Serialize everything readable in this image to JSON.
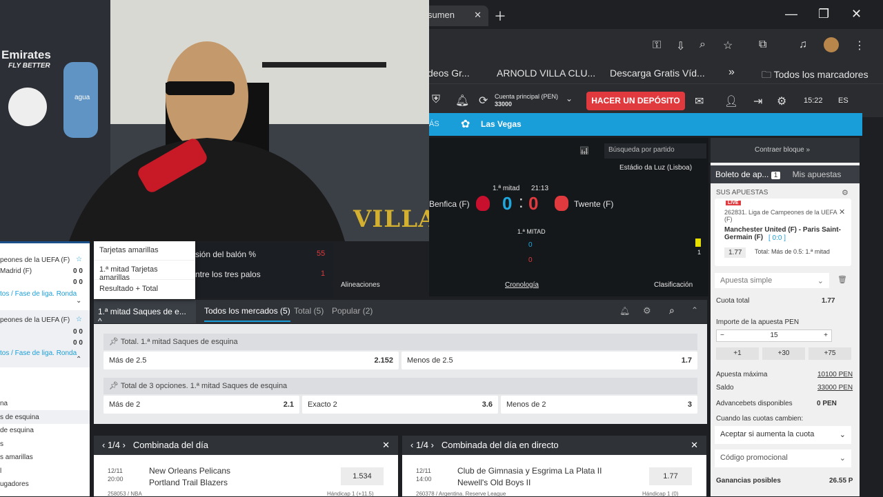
{
  "browser": {
    "tab_title": "sumen",
    "url": "2007-benfica-women-twente-women",
    "bookmarks": [
      "deos Gr...",
      "ARNOLD VILLA CLU...",
      "Descarga Gratis Víd...",
      "Todos los marcadores"
    ]
  },
  "site": {
    "account_label": "Cuenta principal (PEN)",
    "account_value": "33000",
    "deposit_button": "HACER UN DEPÓSITO",
    "time": "15:22",
    "lang": "ES",
    "nav_more": "ÁS",
    "nav_lasvegas": "Las Vegas",
    "search_placeholder": "Búsqueda por partido"
  },
  "match": {
    "stadium": "Estádio da Luz (Lisboa)",
    "period": "1.ª mitad",
    "clock": "21:13",
    "home": "Benfica (F)",
    "away": "Twente (F)",
    "home_score": "0",
    "separator": ":",
    "away_score": "0",
    "half_label": "1.ª MITAD",
    "stat_home": "0",
    "stat_away": "0",
    "stat_side": "1",
    "links": [
      "Alineaciones",
      "Cronología",
      "Clasificación"
    ],
    "stat_rows": [
      {
        "label": "sión del balón %",
        "value": "55"
      },
      {
        "label": "ntre los tres palos",
        "value": "1"
      }
    ]
  },
  "dropdown": [
    "Tarjetas amarillas",
    "1.ª mitad Tarjetas amarillas",
    "Resultado + Total"
  ],
  "markets": {
    "selected": "1.ª mitad Saques de e...",
    "tabs": [
      "Todos los mercados (5)",
      "Total (5)",
      "Popular (2)"
    ],
    "groups": [
      {
        "title": "Total. 1.ª mitad Saques de esquina",
        "odds": [
          {
            "label": "Más de 2.5",
            "value": "2.152"
          },
          {
            "label": "Menos de 2.5",
            "value": "1.7"
          }
        ]
      },
      {
        "title": "Total de 3 opciones. 1.ª mitad Saques de esquina",
        "odds": [
          {
            "label": "Más de 2",
            "value": "2.1"
          },
          {
            "label": "Exacto 2",
            "value": "3.6"
          },
          {
            "label": "Menos de 2",
            "value": "3"
          }
        ]
      }
    ]
  },
  "combo": [
    {
      "nav": "1/4",
      "title": "Combinada del día",
      "date": "12/11",
      "time": "20:00",
      "team1": "New Orleans Pelicans",
      "team2": "Portland Trail Blazers",
      "odd": "1.534",
      "footer": "258053 / NBA",
      "footer_right": "Hándicap 1 (+11.5)"
    },
    {
      "nav": "1/4",
      "title": "Combinada del día en directo",
      "date": "12/11",
      "time": "14:00",
      "team1": "Club de Gimnasia y Esgrima La Plata II",
      "team2": "Newell's Old Boys II",
      "odd": "1.77",
      "footer": "260378 / Argentina. Reserve League",
      "footer_right": "Hándicap 1 (0)"
    }
  ],
  "betslip": {
    "collapse": "Contraer bloque",
    "tab_slip": "Boleto de ap...",
    "tab_count": "1",
    "tab_mine": "Mis apuestas",
    "your_bets": "SUS APUESTAS",
    "live": "LIVE",
    "league": "262831. Liga de Campeones de la UEFA (F)",
    "teams": "Manchester United (F) - Paris Saint-Germain (F)",
    "score": "[ 0:0 ]",
    "odd": "1.77",
    "market": "Total: Más de 0.5: 1.ª mitad",
    "bet_type": "Apuesta simple",
    "total_label": "Cuota total",
    "total_value": "1.77",
    "stake_label": "Importe de la apuesta PEN",
    "stake_value": "15",
    "quick": [
      "+1",
      "+30",
      "+75"
    ],
    "max_label": "Apuesta máxima",
    "max_value": "10100 PEN",
    "balance_label": "Saldo",
    "balance_value": "33000 PEN",
    "adv_label": "Advancebets disponibles",
    "adv_value": "0 PEN",
    "change_label": "Cuando las cuotas cambien:",
    "change_value": "Aceptar si aumenta la cuota",
    "promo": "Código promocional",
    "win_label": "Ganancias posibles",
    "win_value": "26.55 P"
  },
  "left": {
    "league1": "peones de la UEFA (F)",
    "team1": "Madrid (F)",
    "score_a": "0 0",
    "score_b": "0 0",
    "link1": "tos / Fase de liga. Ronda",
    "league2": "peones de la UEFA (F)",
    "score_c": "0 0",
    "score_d": "0 0",
    "link2": "tos / Fase de liga. Ronda",
    "list": [
      "na",
      "s de esquina",
      "de esquina",
      "s",
      "s amarillas",
      "l",
      "ugadores"
    ]
  },
  "webcam": {
    "overlay": "VILLA",
    "sponsor": "Emirates",
    "sponsor_sub": "FLY BETTER",
    "brand": "agua"
  }
}
